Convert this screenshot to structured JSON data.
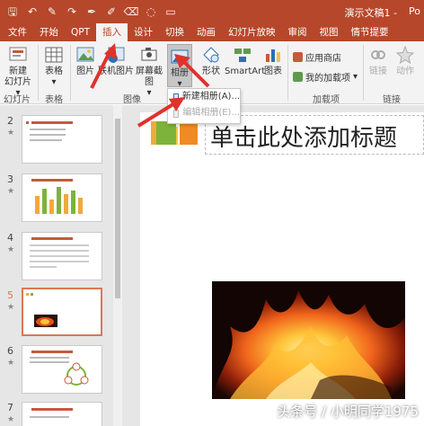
{
  "quick_access": [
    "save-icon",
    "undo-icon",
    "format-painter-icon",
    "redo-icon",
    "pen-icon",
    "highlighter-icon",
    "eraser-icon",
    "lasso-icon",
    "shapes-icon"
  ],
  "window": {
    "title": "演示文稿1 -",
    "title_more": "Po"
  },
  "tabs": [
    "文件",
    "开始",
    "QPT",
    "插入",
    "设计",
    "切换",
    "动画",
    "幻灯片放映",
    "审阅",
    "视图",
    "情节提要"
  ],
  "active_tab_index": 3,
  "ribbon": {
    "new_slide": "新建\n幻灯片",
    "new_slide_label": "新建",
    "new_slide_label2": "幻灯片 ▾",
    "table": "表格",
    "picture": "图片",
    "online_picture": "联机图片",
    "screenshot": "屏幕截图",
    "album": "相册",
    "shapes": "形状",
    "smartart": "SmartArt",
    "chart": "图表",
    "store": "应用商店",
    "my_addins": "我的加载项",
    "link": "链接",
    "action": "动作",
    "groups": {
      "slides": "幻灯片",
      "tables": "表格",
      "images": "图像",
      "addins": "加载项",
      "links": "链接"
    }
  },
  "album_menu": {
    "new": "新建相册(A)...",
    "edit": "编辑相册(E)..."
  },
  "thumbnails": [
    {
      "num": "2",
      "star": "★"
    },
    {
      "num": "3",
      "star": "★"
    },
    {
      "num": "4",
      "star": "★"
    },
    {
      "num": "5",
      "star": "★"
    },
    {
      "num": "6",
      "star": "★"
    },
    {
      "num": "7",
      "star": "★"
    }
  ],
  "slide": {
    "title_placeholder": "单击此处添加标题"
  },
  "watermark": "头条号 / 小明同学1975",
  "colors": {
    "accent": "#b7472a",
    "selection": "#e0764e",
    "arrow": "#e0322c"
  }
}
